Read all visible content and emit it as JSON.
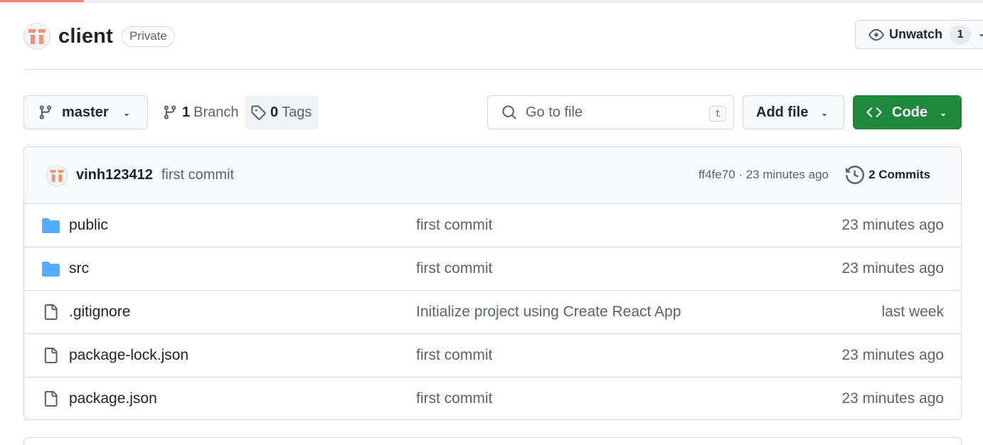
{
  "repo": {
    "name": "client",
    "visibility": "Private"
  },
  "watch": {
    "label": "Unwatch",
    "count": "1"
  },
  "toolbar": {
    "branch": "master",
    "branches_count": "1",
    "branches_label": "Branch",
    "tags_count": "0",
    "tags_label": "Tags",
    "search_placeholder": "Go to file",
    "search_shortcut": "t",
    "add_file_label": "Add file",
    "code_label": "Code"
  },
  "latest_commit": {
    "author": "vinh123412",
    "message": "first commit",
    "hash_and_time": "ff4fe70 · 23 minutes ago",
    "commits_label": "2 Commits"
  },
  "files": [
    {
      "type": "folder",
      "name": "public",
      "message": "first commit",
      "time": "23 minutes ago"
    },
    {
      "type": "folder",
      "name": "src",
      "message": "first commit",
      "time": "23 minutes ago"
    },
    {
      "type": "file",
      "name": ".gitignore",
      "message": "Initialize project using Create React App",
      "time": "last week"
    },
    {
      "type": "file",
      "name": "package-lock.json",
      "message": "first commit",
      "time": "23 minutes ago"
    },
    {
      "type": "file",
      "name": "package.json",
      "message": "first commit",
      "time": "23 minutes ago"
    }
  ],
  "colors": {
    "accent_green": "#1f883d",
    "folder_blue": "#54aeff",
    "progress": "#f2876c",
    "muted_text": "#59636e"
  }
}
